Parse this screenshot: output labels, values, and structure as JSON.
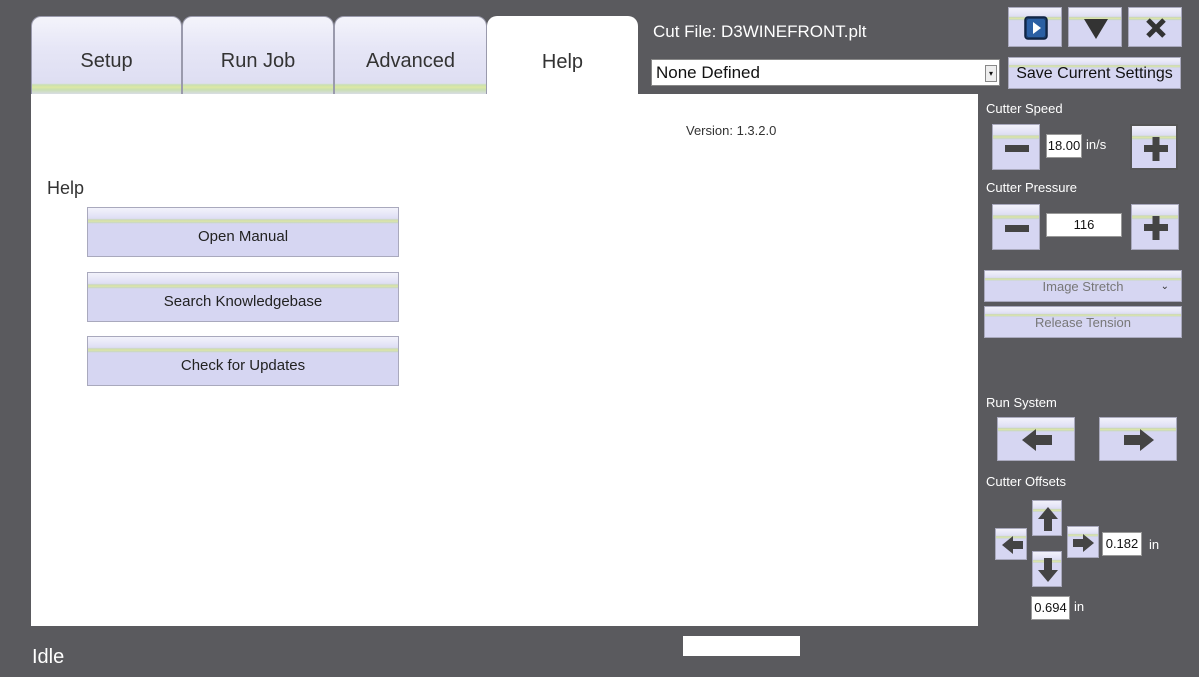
{
  "tabs": [
    {
      "label": "Setup"
    },
    {
      "label": "Run Job"
    },
    {
      "label": "Advanced"
    },
    {
      "label": "Help"
    }
  ],
  "active_tab": "Help",
  "header": {
    "cut_file": "Cut File: D3WINEFRONT.plt",
    "profile_value": "None Defined",
    "save_label": "Save Current Settings"
  },
  "window_buttons": [
    "play-icon",
    "minimize-icon",
    "close-icon"
  ],
  "help": {
    "title": "Help",
    "version": "Version: 1.3.2.0",
    "buttons": [
      {
        "label": "Open Manual"
      },
      {
        "label": "Search Knowledgebase"
      },
      {
        "label": "Check for Updates"
      }
    ]
  },
  "side": {
    "cutter_speed_label": "Cutter Speed",
    "cutter_speed_value": "18.00",
    "cutter_speed_unit": "in/s",
    "cutter_pressure_label": "Cutter Pressure",
    "cutter_pressure_value": "116",
    "image_stretch_label": "Image Stretch",
    "release_tension_label": "Release Tension",
    "run_system_label": "Run System",
    "cutter_offsets_label": "Cutter Offsets",
    "offset_x_value": "0.182",
    "offset_x_unit": "in",
    "offset_y_value": "0.694",
    "offset_y_unit": "in"
  },
  "status": {
    "text": "Idle"
  },
  "colors": {
    "background": "#5a5a5e",
    "panel": "#ffffff",
    "button_face": "#d6d6f2",
    "button_stripe": "#dde8a4"
  }
}
